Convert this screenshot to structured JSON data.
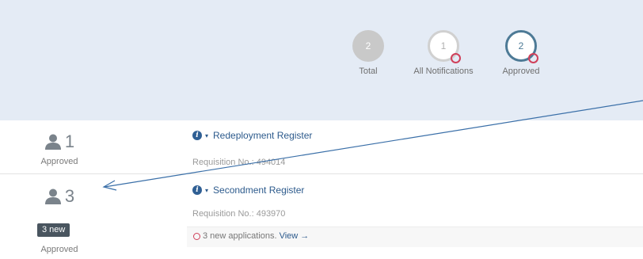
{
  "stats": [
    {
      "value": "2",
      "label": "Total"
    },
    {
      "value": "1",
      "label": "All Notifications"
    },
    {
      "value": "2",
      "label": "Approved"
    }
  ],
  "rows": [
    {
      "count": "1",
      "status": "Approved",
      "title": "Redeployment Register",
      "requisition": "Requisition No.: 494014"
    },
    {
      "count": "3",
      "badge": "3 new",
      "status": "Approved",
      "title": "Secondment Register",
      "requisition": "Requisition No.: 493970",
      "notice_text": "3 new applications.",
      "notice_link": "View →"
    }
  ],
  "colors": {
    "header_bg": "#e4ebf5",
    "link": "#2c5a8c",
    "alert": "#d0405a",
    "arrow": "#3a6fa8"
  },
  "icons": [
    "user-icon",
    "info-icon",
    "chevron-down-icon",
    "alert-circle-icon"
  ]
}
